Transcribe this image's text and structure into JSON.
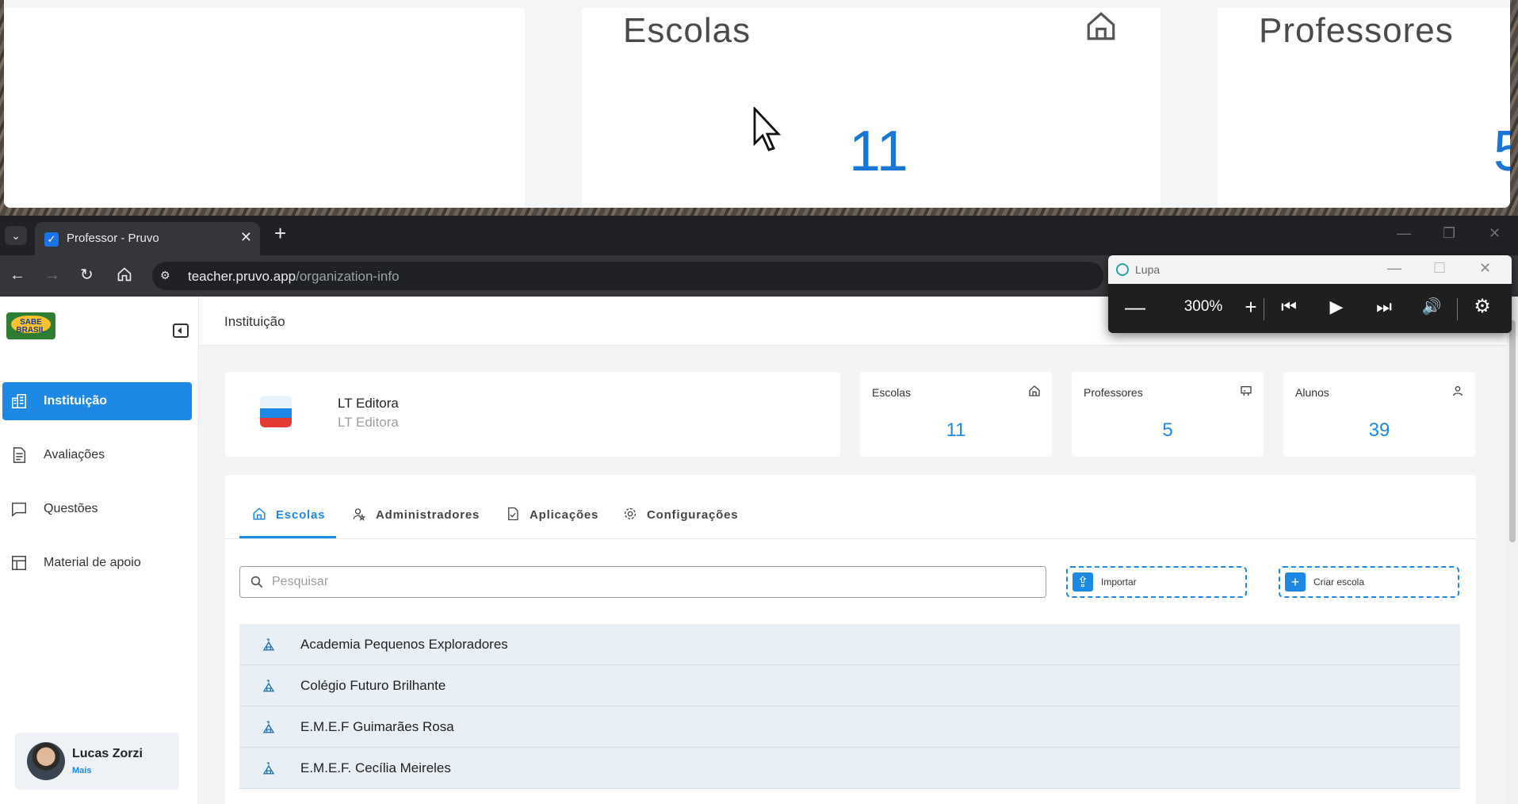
{
  "magnifier_view": {
    "card1_title": "Escolas",
    "card1_value": "11",
    "card2_title": "Professores",
    "card2_value": "5"
  },
  "browser": {
    "tab_title": "Professor - Pruvo",
    "url_host": "teacher.pruvo.app",
    "url_path": "/organization-info"
  },
  "sidebar": {
    "logo_text": "SABE BRASIL",
    "items": [
      {
        "label": "Instituição",
        "icon": "building-icon",
        "active": true
      },
      {
        "label": "Avaliações",
        "icon": "document-icon",
        "active": false
      },
      {
        "label": "Questões",
        "icon": "chat-icon",
        "active": false
      },
      {
        "label": "Material de apoio",
        "icon": "layout-icon",
        "active": false
      }
    ],
    "user": {
      "name": "Lucas Zorzi",
      "more": "Mais"
    }
  },
  "header": {
    "title": "Instituição"
  },
  "organization": {
    "name": "LT Editora",
    "subtitle": "LT Editora"
  },
  "stats": [
    {
      "label": "Escolas",
      "value": "11",
      "icon": "house-icon"
    },
    {
      "label": "Professores",
      "value": "5",
      "icon": "presentation-icon"
    },
    {
      "label": "Alunos",
      "value": "39",
      "icon": "person-icon"
    }
  ],
  "tabs": [
    {
      "label": "Escolas",
      "icon": "house-icon",
      "active": true
    },
    {
      "label": "Administradores",
      "icon": "user-star-icon",
      "active": false
    },
    {
      "label": "Aplicações",
      "icon": "file-check-icon",
      "active": false
    },
    {
      "label": "Configurações",
      "icon": "gear-icon",
      "active": false
    }
  ],
  "search": {
    "placeholder": "Pesquisar",
    "value": ""
  },
  "actions": {
    "import_label": "Importar",
    "create_label": "Criar escola"
  },
  "schools": [
    "Academia Pequenos Exploradores",
    "Colégio Futuro Brilhante",
    "E.M.E.F Guimarães Rosa",
    "E.M.E.F. Cecília Meireles"
  ],
  "lupa": {
    "title": "Lupa",
    "zoom": "300%"
  },
  "colors": {
    "accent": "#1e88e5",
    "sidebar_active": "#1e88e5"
  }
}
